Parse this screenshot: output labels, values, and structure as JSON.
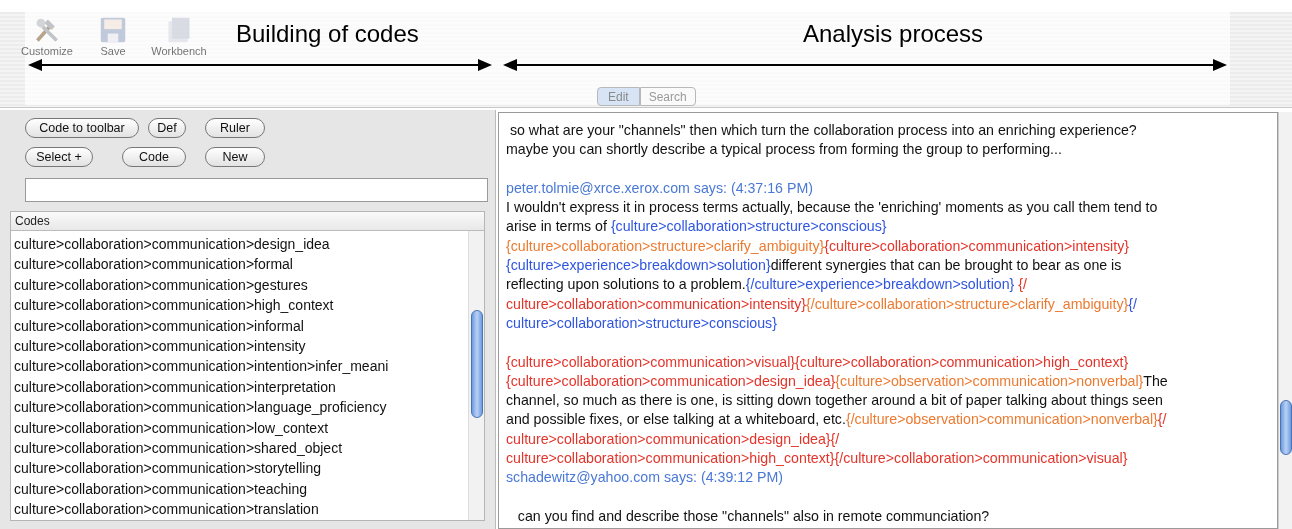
{
  "toolbar": [
    {
      "label": "Customize",
      "kind": "tools"
    },
    {
      "label": "Save",
      "kind": "disk"
    },
    {
      "label": "Workbench",
      "kind": "bench"
    }
  ],
  "annotations": [
    {
      "label": "Building of codes"
    },
    {
      "label": "Analysis process"
    }
  ],
  "tabs": [
    {
      "label": "Edit",
      "selected": true
    },
    {
      "label": "Search",
      "selected": false
    }
  ],
  "buttons": [
    [
      "Code to toolbar",
      "Def",
      "Ruler"
    ],
    [
      "Select +",
      "Code",
      "New"
    ]
  ],
  "codes": {
    "header": "Codes",
    "items": [
      "culture>collaboration>communication>design_idea",
      "culture>collaboration>communication>formal",
      "culture>collaboration>communication>gestures",
      "culture>collaboration>communication>high_context",
      "culture>collaboration>communication>informal",
      "culture>collaboration>communication>intensity",
      "culture>collaboration>communication>intention>infer_meani",
      "culture>collaboration>communication>interpretation",
      "culture>collaboration>communication>language_proficiency",
      "culture>collaboration>communication>low_context",
      "culture>collaboration>communication>shared_object",
      "culture>collaboration>communication>storytelling",
      "culture>collaboration>communication>teaching",
      "culture>collaboration>communication>translation"
    ]
  },
  "transcript": [
    {
      "lines": [
        [
          {
            "text": " so what are your \"channels\" then which turn the collaboration process into an enriching experience?",
            "color": "#111111"
          }
        ],
        [
          {
            "text": "maybe you can shortly describe a typical process from forming the group to performing...",
            "color": "#111111"
          }
        ]
      ]
    },
    {
      "lines": [
        [
          {
            "text": "peter.tolmie@xrce.xerox.com says: (4:37:16 PM)",
            "color": "#4a78d6"
          }
        ],
        [
          {
            "text": "I wouldn't express it in process terms actually, because the 'enriching' moments as you call them tend to",
            "color": "#111111"
          }
        ],
        [
          {
            "text": "arise in terms of ",
            "color": "#111111"
          },
          {
            "text": "{culture>collaboration>structure>conscious}",
            "color": "#2f55e0"
          }
        ],
        [
          {
            "text": "{culture>collaboration>structure>clarify_ambiguity}",
            "color": "#ec7a30"
          },
          {
            "text": "{culture>collaboration>communication>intensity}",
            "color": "#e4342a"
          }
        ],
        [
          {
            "text": "{culture>experience>breakdown>solution}",
            "color": "#2f55e0"
          },
          {
            "text": "different synergies that can be brought to bear as one is",
            "color": "#111111"
          }
        ],
        [
          {
            "text": "reflecting upon solutions to a problem.",
            "color": "#111111"
          },
          {
            "text": "{/culture>experience>breakdown>solution}",
            "color": "#2f55e0"
          },
          {
            "text": " {/",
            "color": "#e4342a"
          }
        ],
        [
          {
            "text": "culture>collaboration>communication>intensity}",
            "color": "#e4342a"
          },
          {
            "text": "{/culture>collaboration>structure>clarify_ambiguity}",
            "color": "#ec7a30"
          },
          {
            "text": "{/",
            "color": "#2f55e0"
          }
        ],
        [
          {
            "text": "culture>collaboration>structure>conscious}",
            "color": "#2f55e0"
          }
        ]
      ]
    },
    {
      "lines": [
        [
          {
            "text": "{culture>collaboration>communication>visual}{culture>collaboration>communication>high_context}",
            "color": "#e4342a"
          }
        ],
        [
          {
            "text": "{culture>collaboration>communication>design_idea}",
            "color": "#e4342a"
          },
          {
            "text": "{culture>observation>communication>nonverbal}",
            "color": "#ec7a30"
          },
          {
            "text": "The",
            "color": "#111111"
          }
        ],
        [
          {
            "text": "channel, so much as there is one, is sitting down together around a bit of paper talking about things seen",
            "color": "#111111"
          }
        ],
        [
          {
            "text": "and possible fixes, or else talking at a whiteboard, etc.",
            "color": "#111111"
          },
          {
            "text": "{/culture>observation>communication>nonverbal}",
            "color": "#ec7a30"
          },
          {
            "text": "{/",
            "color": "#e4342a"
          }
        ],
        [
          {
            "text": "culture>collaboration>communication>design_idea}{/",
            "color": "#e4342a"
          }
        ],
        [
          {
            "text": "culture>collaboration>communication>high_context}{/culture>collaboration>communication>visual}",
            "color": "#e4342a"
          }
        ],
        [
          {
            "text": "schadewitz@yahoo.com says: (4:39:12 PM)",
            "color": "#4a78d6"
          }
        ]
      ]
    },
    {
      "lines": [
        [
          {
            "text": "   can you find and describe those \"channels\" also in remote communciation?",
            "color": "#111111"
          }
        ]
      ]
    }
  ]
}
